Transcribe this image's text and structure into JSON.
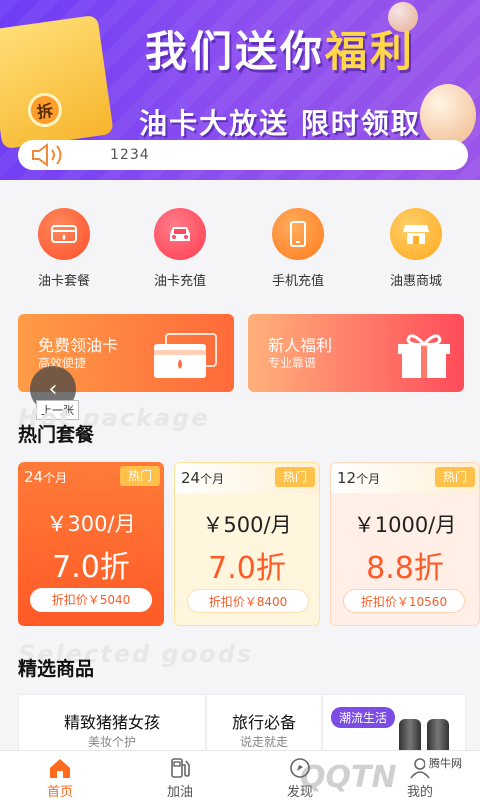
{
  "banner": {
    "title_main": "我们送你",
    "title_highlight": "福利",
    "subtitle": "油卡大放送 限时领取",
    "envelope_text": "拆",
    "notice_text": "1234"
  },
  "quick_menu": [
    {
      "label": "油卡套餐",
      "icon": "oil-card-icon",
      "color": "#ff5a3c"
    },
    {
      "label": "油卡充值",
      "icon": "car-icon",
      "color": "#ff4d5f"
    },
    {
      "label": "手机充值",
      "icon": "phone-icon",
      "color": "#ff8a2b"
    },
    {
      "label": "油惠商城",
      "icon": "shop-icon",
      "color": "#ffb02e"
    }
  ],
  "promos": [
    {
      "title": "免费领油卡",
      "sub": "高效便捷"
    },
    {
      "title": "新人福利",
      "sub": "专业靠谱"
    }
  ],
  "carousel": {
    "prev_tooltip": "上一张"
  },
  "hot_section": {
    "ghost": "Hot package",
    "title": "热门套餐"
  },
  "packages": [
    {
      "months": "24",
      "unit": "个月",
      "tag": "热门",
      "price": "￥300/月",
      "discount": "7.0折",
      "original": "折扣价￥5040"
    },
    {
      "months": "24",
      "unit": "个月",
      "tag": "热门",
      "price": "￥500/月",
      "discount": "7.0折",
      "original": "折扣价￥8400"
    },
    {
      "months": "12",
      "unit": "个月",
      "tag": "热门",
      "price": "￥1000/月",
      "discount": "8.8折",
      "original": "折扣价￥10560"
    }
  ],
  "goods_section": {
    "ghost": "Selected goods",
    "title": "精选商品"
  },
  "goods": [
    {
      "title": "精致猪猪女孩",
      "sub": "美妆个护"
    },
    {
      "title": "旅行必备",
      "sub": "说走就走"
    },
    {
      "badge": "潮流生活"
    }
  ],
  "tabs": [
    {
      "label": "首页",
      "active": true
    },
    {
      "label": "加油",
      "active": false
    },
    {
      "label": "发现",
      "active": false
    },
    {
      "label": "我的",
      "active": false
    }
  ],
  "watermark": {
    "text": "腾牛网",
    "logo": "QQTN"
  }
}
